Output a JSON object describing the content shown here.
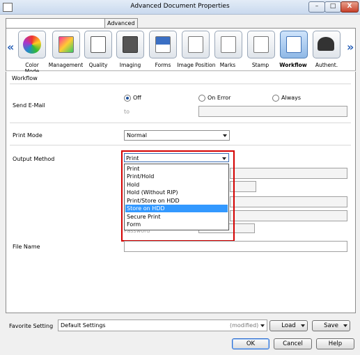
{
  "window": {
    "title": "Advanced Document Properties",
    "minimize": "–",
    "maximize": "□",
    "close": "X"
  },
  "tabs": [
    {
      "label": ""
    },
    {
      "label": "Advanced"
    }
  ],
  "nav": {
    "prev": "«",
    "next": "»"
  },
  "toolbar": [
    {
      "label": "Color\nMode",
      "icon": "color-mode-icon"
    },
    {
      "label": "Management",
      "icon": "management-icon"
    },
    {
      "label": "Quality",
      "icon": "quality-icon"
    },
    {
      "label": "Imaging",
      "icon": "imaging-icon"
    },
    {
      "label": "Forms",
      "icon": "forms-icon"
    },
    {
      "label": "Image Position",
      "icon": "image-position-icon"
    },
    {
      "label": "Marks",
      "icon": "marks-icon"
    },
    {
      "label": "Stamp",
      "icon": "stamp-icon"
    },
    {
      "label": "Workflow",
      "icon": "workflow-icon",
      "selected": true
    },
    {
      "label": "Authent.",
      "icon": "authentication-icon"
    }
  ],
  "panel": {
    "section_title": "Workflow",
    "send_email": {
      "label": "Send E-Mail",
      "options": [
        "Off",
        "On Error",
        "Always"
      ],
      "selected": "Off",
      "to_label": "to",
      "to_value": ""
    },
    "print_mode": {
      "label": "Print Mode",
      "value": "Normal"
    },
    "output_method": {
      "label": "Output Method",
      "value": "Print",
      "options": [
        "Print",
        "Print/Hold",
        "Hold",
        "Hold (Without RIP)",
        "Print/Store on HDD",
        "Store on HDD",
        "Secure Print",
        "Form"
      ],
      "highlighted": "Store on HDD"
    },
    "password": {
      "label": "Password",
      "value": "••••••••"
    },
    "file_name": {
      "label": "File Name",
      "value": ""
    }
  },
  "footer": {
    "favorite_label": "Favorite Setting",
    "favorite_value": "Default Settings",
    "favorite_state": "(modified)",
    "load": "Load",
    "save": "Save",
    "ok": "OK",
    "cancel": "Cancel",
    "help": "Help"
  }
}
